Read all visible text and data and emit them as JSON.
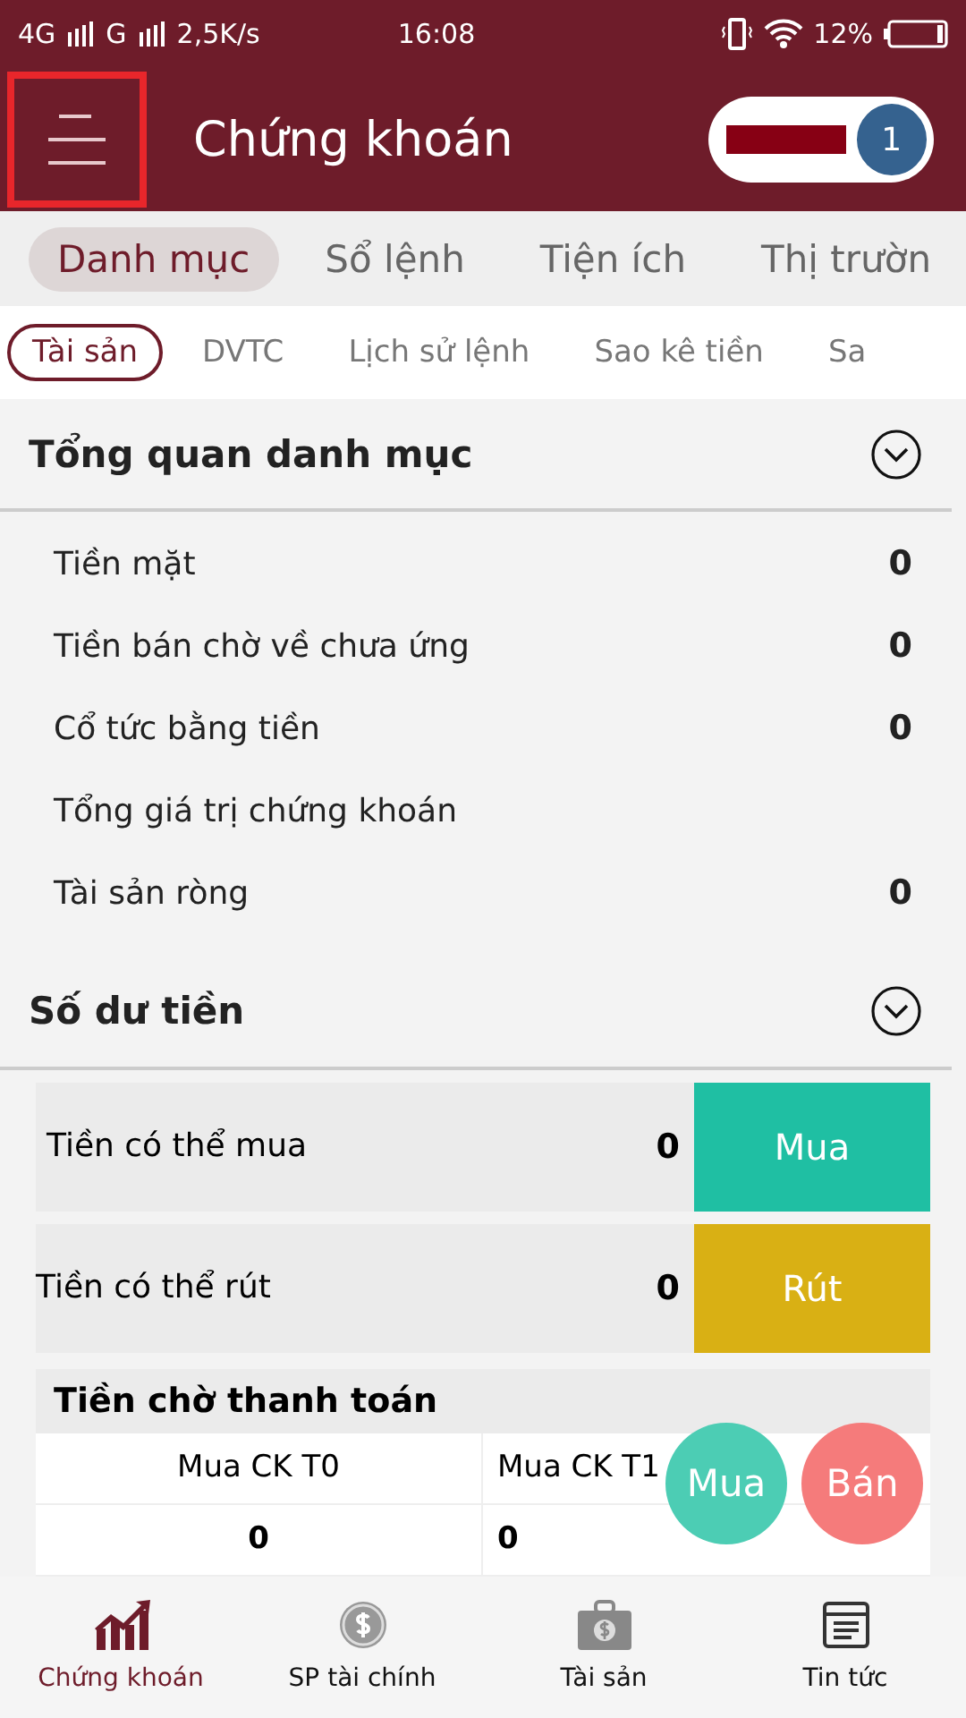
{
  "status_bar": {
    "network": "4G",
    "network_2": "G",
    "speed": "2,5K/s",
    "time": "16:08",
    "battery": "12%"
  },
  "header": {
    "title": "Chứng khoán",
    "menu_highlighted": true,
    "badge": "1"
  },
  "tabs": [
    {
      "label": "Danh mục",
      "selected": true
    },
    {
      "label": "Sổ lệnh",
      "selected": false
    },
    {
      "label": "Tiện ích",
      "selected": false
    },
    {
      "label": "Thị trườn",
      "selected": false
    }
  ],
  "subtabs": [
    {
      "label": "Tài sản",
      "selected": true
    },
    {
      "label": "DVTC",
      "selected": false
    },
    {
      "label": "Lịch sử lệnh",
      "selected": false
    },
    {
      "label": "Sao kê tiền",
      "selected": false
    },
    {
      "label": "Sa",
      "selected": false
    }
  ],
  "overview": {
    "title": "Tổng quan danh mục",
    "expanded": true,
    "rows": [
      {
        "label": "Tiền mặt",
        "value": "0"
      },
      {
        "label": "Tiền bán chờ về chưa ứng",
        "value": "0"
      },
      {
        "label": "Cổ tức bằng tiền",
        "value": "0"
      },
      {
        "label": "Tổng giá trị chứng khoán"
      },
      {
        "label": "Tài sản ròng",
        "value": "0"
      }
    ]
  },
  "balance": {
    "title": "Số dư tiền",
    "expanded": true,
    "rows": [
      {
        "label": "Tiền có thể mua",
        "value": "0",
        "action": "Mua",
        "color": "#1fbfa3"
      },
      {
        "label": "Tiền có thể rút",
        "value": "0",
        "action": "Rút",
        "color": "#d9b014"
      }
    ],
    "pending": {
      "title": "Tiền chờ thanh toán",
      "columns": [
        "Mua CK T0",
        "Mua CK T1"
      ],
      "values": [
        "0",
        "0"
      ]
    }
  },
  "fabs": [
    {
      "label": "Mua",
      "color": "#4ccdb4"
    },
    {
      "label": "Bán",
      "color": "#f57b7b"
    }
  ],
  "bottom_nav": [
    {
      "label": "Chứng khoán",
      "kind": "chart",
      "selected": true
    },
    {
      "label": "SP tài chính",
      "kind": "coin",
      "selected": false
    },
    {
      "label": "Tài sản",
      "kind": "bag",
      "selected": false
    },
    {
      "label": "Tin tức",
      "kind": "news",
      "selected": false
    }
  ]
}
